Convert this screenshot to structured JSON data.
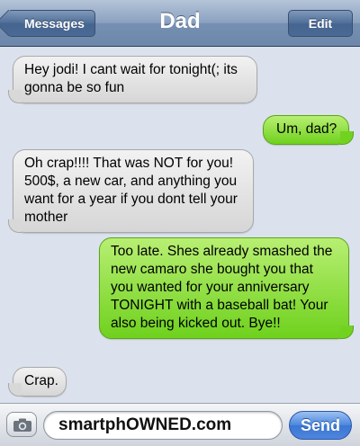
{
  "navbar": {
    "back_label": "Messages",
    "title": "Dad",
    "edit_label": "Edit"
  },
  "messages": [
    {
      "side": "received",
      "text": "Hey jodi! I cant wait for tonight(; its gonna be so fun"
    },
    {
      "side": "sent",
      "text": "Um, dad?"
    },
    {
      "side": "received",
      "text": "Oh crap!!!! That was NOT for you! 500$, a new car, and anything you want for a year if you dont tell your mother"
    },
    {
      "side": "sent",
      "text": "Too late. Shes already smashed the new camaro she bought you that you wanted for your anniversary TONIGHT with a baseball bat! Your also being kicked out. Bye!!"
    },
    {
      "side": "received",
      "text": "Crap."
    }
  ],
  "input_bar": {
    "camera_icon": "camera-icon",
    "field_text": "smartphOWNED.com",
    "send_label": "Send"
  },
  "colors": {
    "received_bubble": "#e4e4e4",
    "sent_bubble": "#8ee04a",
    "send_button": "#4a84dc",
    "nav": "#7a93b6"
  }
}
